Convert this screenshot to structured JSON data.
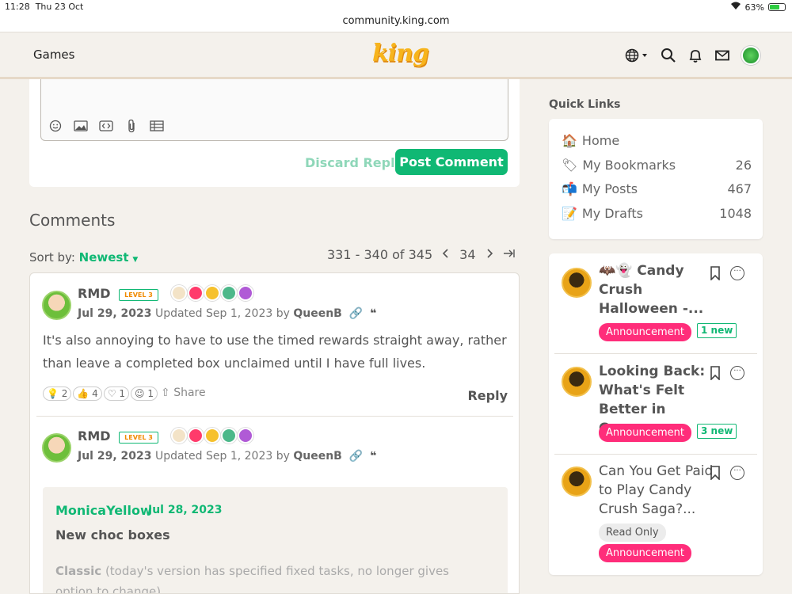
{
  "status": {
    "time": "11:28",
    "date": "Thu 23 Oct",
    "battery": "63%"
  },
  "url": "community.king.com",
  "header": {
    "games_label": "Games",
    "logo_text": "king"
  },
  "editor": {
    "discard_label": "Discard Reply",
    "post_label": "Post Comment"
  },
  "comments": {
    "title": "Comments",
    "sort_label": "Sort by:",
    "sort_value": "Newest",
    "range": "331 - 340 of 345",
    "page": "34"
  },
  "comment1": {
    "author": "RMD",
    "level": "LEVEL 3",
    "date": "Jul 29, 2023",
    "updated_label": "Updated",
    "updated_date": "Sep 1, 2023",
    "by_label": "by",
    "editor": "QueenB",
    "text": "It's also annoying to have to use the timed rewards straight away, rather than leave a completed box unclaimed until I have full lives.",
    "reactions": {
      "insightful": "2",
      "like": "4",
      "love": "1",
      "lol": "1"
    },
    "share_label": "Share",
    "reply_label": "Reply"
  },
  "comment2": {
    "author": "RMD",
    "level": "LEVEL 3",
    "date": "Jul 29, 2023",
    "updated_label": "Updated",
    "updated_date": "Sep 1, 2023",
    "by_label": "by",
    "editor": "QueenB",
    "quote": {
      "author": "MonicaYellow",
      "date": "Jul 28, 2023",
      "title": "New choc boxes",
      "body_bold": "Classic",
      "body": " (today's version has specified fixed tasks, no longer gives option to change)"
    }
  },
  "quick_links": {
    "title": "Quick Links",
    "items": [
      {
        "label": "Home",
        "count": ""
      },
      {
        "label": "My Bookmarks",
        "count": "26"
      },
      {
        "label": "My Posts",
        "count": "467"
      },
      {
        "label": "My Drafts",
        "count": "1048"
      }
    ]
  },
  "announcements": [
    {
      "title": "🦇👻 Candy Crush Halloween -...",
      "tag": "Announcement",
      "new": "1 new"
    },
    {
      "title": "Looking Back: What's Felt Better in Can...",
      "tag": "Announcement",
      "new": "3 new"
    },
    {
      "title": "Can You Get Paid to Play Candy Crush Saga?...",
      "tag_ro": "Read Only",
      "tag": "Announcement"
    }
  ],
  "colors": {
    "accent": "#10b874",
    "announcement": "#ff2d7a",
    "level_text": "#f08a00"
  }
}
